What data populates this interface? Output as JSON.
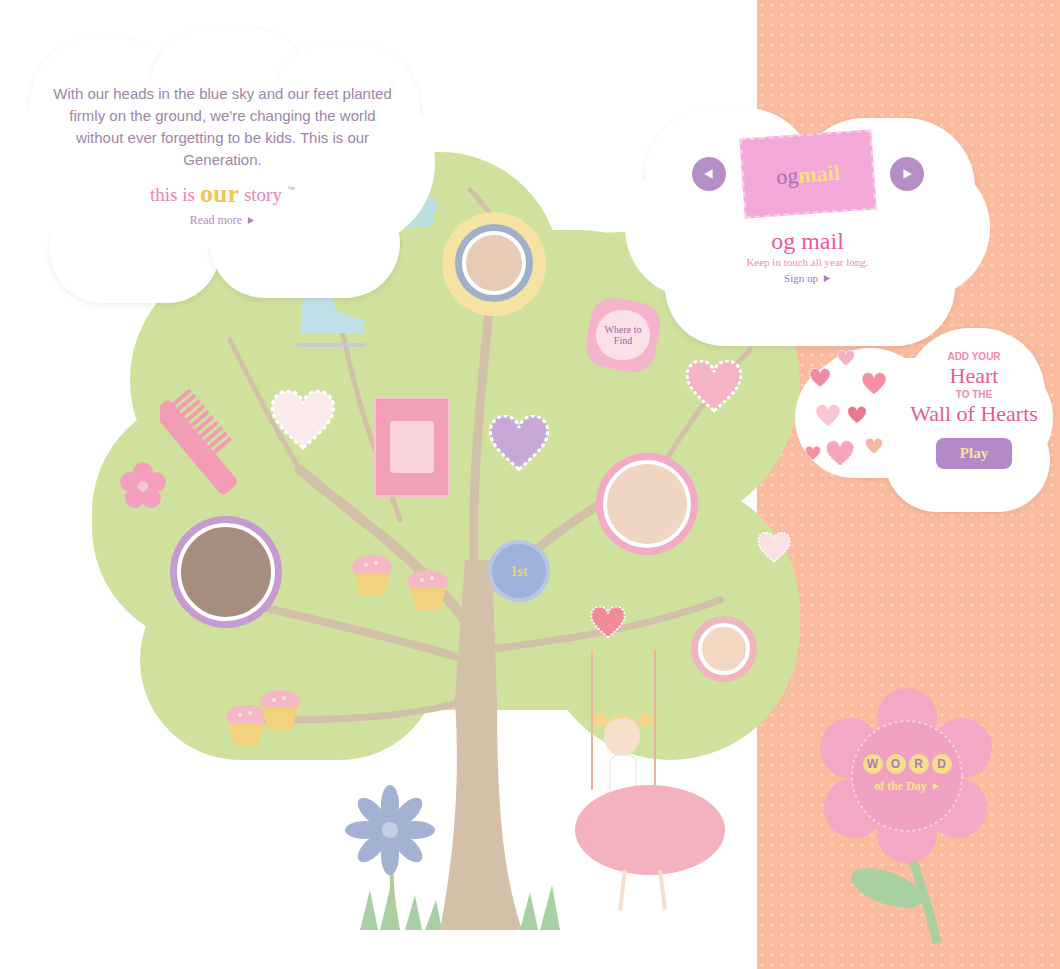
{
  "intro": {
    "text": "With our heads in the blue sky and our feet planted firmly on the ground, we're changing the world without ever forgetting to be kids. This is our Generation.",
    "tagline": {
      "prefix": "this is",
      "highlight": "our",
      "suffix": "story",
      "mark": "™"
    },
    "link": "Read more"
  },
  "tree": {
    "where_to_find": "Where to Find",
    "ribbon": "1st"
  },
  "og_mail": {
    "logo_prefix": "og",
    "logo_highlight": "mail",
    "title": "og mail",
    "subtitle": "Keep in touch all year long.",
    "link": "Sign up"
  },
  "wall_of_hearts": {
    "lines": [
      "ADD YOUR",
      "Heart",
      "TO THE",
      "Wall of Hearts"
    ],
    "button": "Play"
  },
  "word_of_the_day": {
    "letters": [
      "W",
      "O",
      "R",
      "D"
    ],
    "caption": "of the Day"
  }
}
